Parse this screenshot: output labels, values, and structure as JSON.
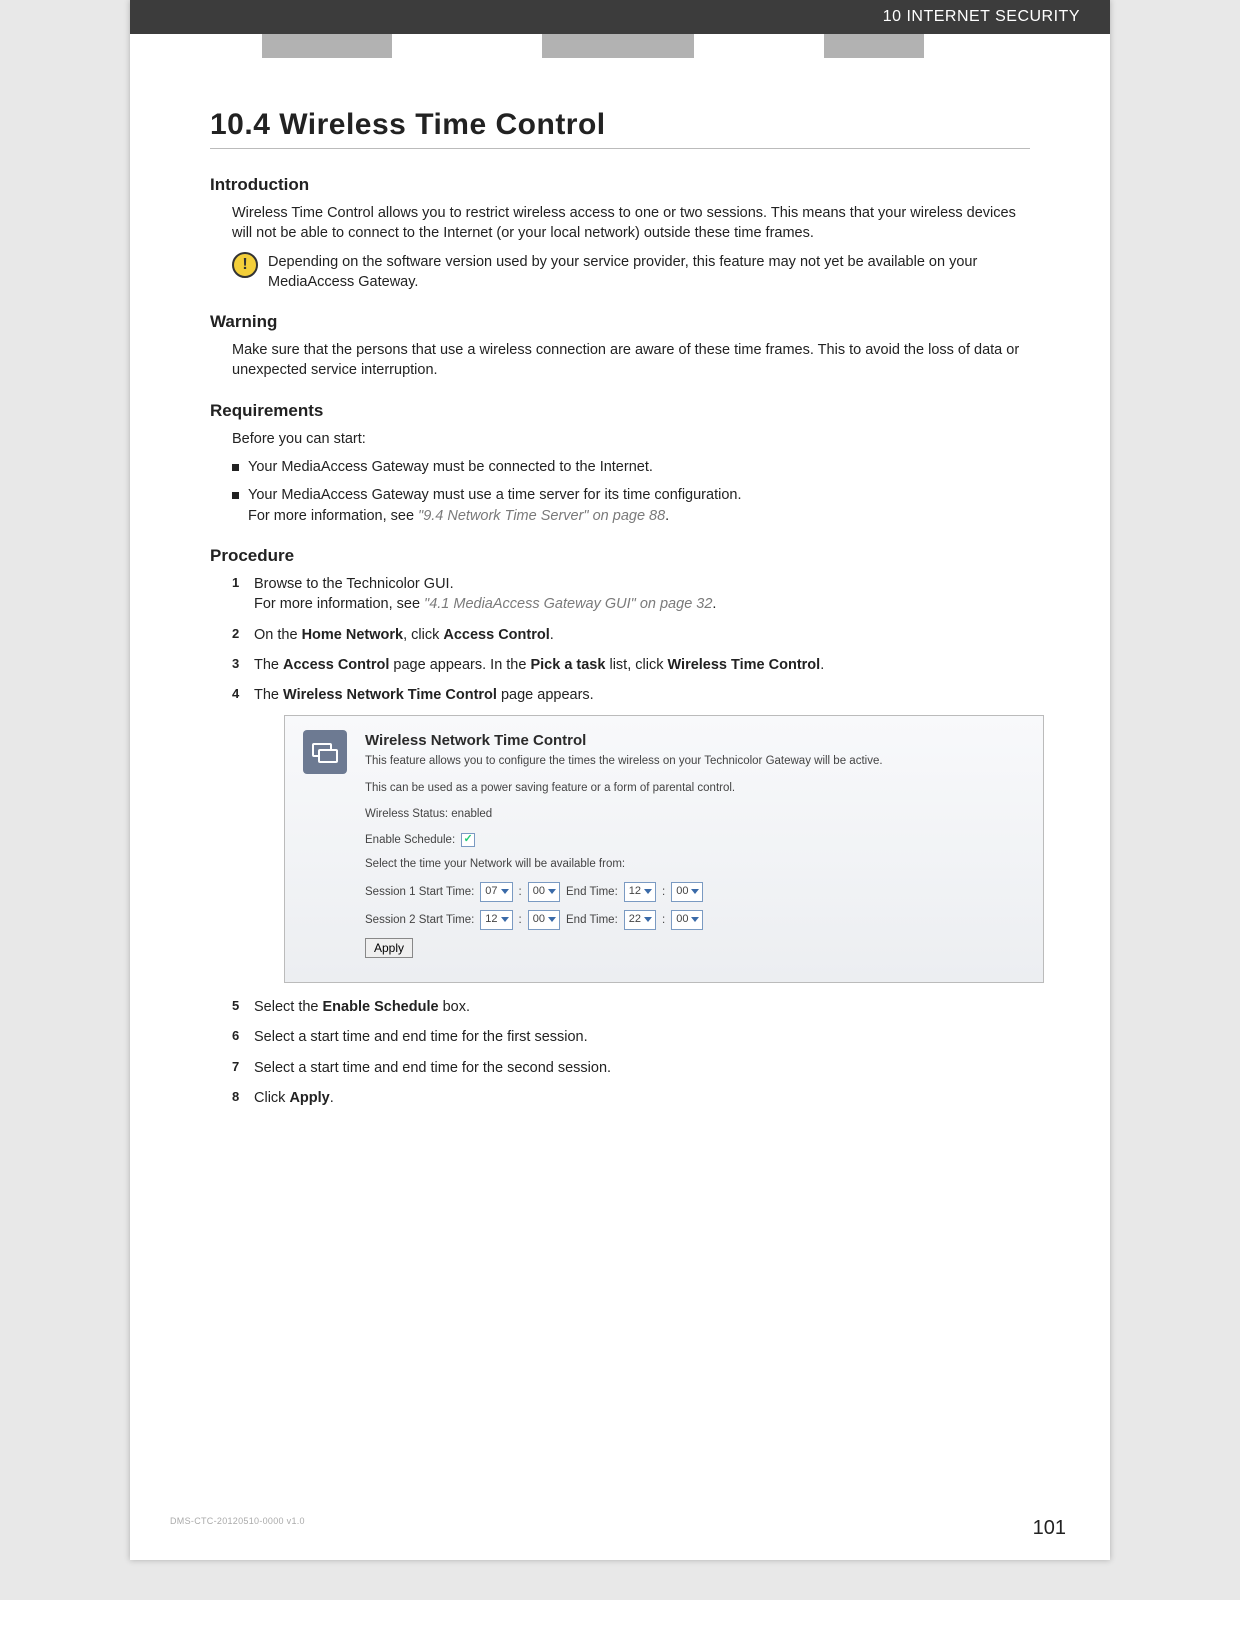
{
  "header": {
    "chapter": "10 INTERNET SECURITY"
  },
  "title": "10.4 Wireless Time Control",
  "intro": {
    "heading": "Introduction",
    "p1": "Wireless Time Control allows you to restrict wireless access to one or two sessions. This means that your wireless devices will not be able to connect to the Internet (or your local network) outside these time frames.",
    "note": "Depending on the software version used by your service provider, this feature may not yet be available on your MediaAccess Gateway."
  },
  "warning": {
    "heading": "Warning",
    "p1": "Make sure that the persons that use a wireless connection are aware of these time frames. This to avoid the loss of data or unexpected service interruption."
  },
  "req": {
    "heading": "Requirements",
    "lead": "Before you can start:",
    "items": [
      {
        "text": "Your MediaAccess Gateway must be connected to the Internet."
      },
      {
        "text_a": "Your MediaAccess Gateway must use a time server for its time configuration.",
        "text_b": "For more information, see ",
        "xref": "\"9.4 Network Time Server\" on page 88",
        "text_c": "."
      }
    ]
  },
  "proc": {
    "heading": "Procedure",
    "steps": {
      "s1a": "Browse to the Technicolor GUI.",
      "s1b": "For more information, see ",
      "s1xref": "\"4.1 MediaAccess Gateway GUI\" on page 32",
      "s1c": ".",
      "s2a": "On the ",
      "s2b": "Home Network",
      "s2c": ", click ",
      "s2d": "Access Control",
      "s2e": ".",
      "s3a": "The ",
      "s3b": "Access Control",
      "s3c": " page appears. In the ",
      "s3d": "Pick a task",
      "s3e": " list, click ",
      "s3f": "Wireless Time Control",
      "s3g": ".",
      "s4a": "The ",
      "s4b": "Wireless Network Time Control",
      "s4c": " page appears.",
      "s5a": "Select the ",
      "s5b": "Enable Schedule",
      "s5c": " box.",
      "s6": "Select a start time and end time for the first session.",
      "s7": "Select a start time and end time for the second session.",
      "s8a": "Click ",
      "s8b": "Apply",
      "s8c": "."
    }
  },
  "ui": {
    "title": "Wireless Network Time Control",
    "desc": "This feature allows you to configure the times the wireless on your Technicolor Gateway will be active.",
    "desc2": "This can be used as a power saving feature or a form of parental control.",
    "status_lbl": "Wireless Status: enabled",
    "enable_lbl": "Enable Schedule:",
    "enable_checked": "✓",
    "select_lbl": "Select the time your Network will be available from:",
    "s1": {
      "start_lbl": "Session 1 Start Time:",
      "h": "07",
      "m": "00",
      "end_lbl": "End Time:",
      "eh": "12",
      "em": "00"
    },
    "s2": {
      "start_lbl": "Session 2 Start Time:",
      "h": "12",
      "m": "00",
      "end_lbl": "End Time:",
      "eh": "22",
      "em": "00"
    },
    "apply": "Apply",
    "colon": ":"
  },
  "footer": {
    "docid": "DMS-CTC-20120510-0000 v1.0",
    "page": "101"
  }
}
